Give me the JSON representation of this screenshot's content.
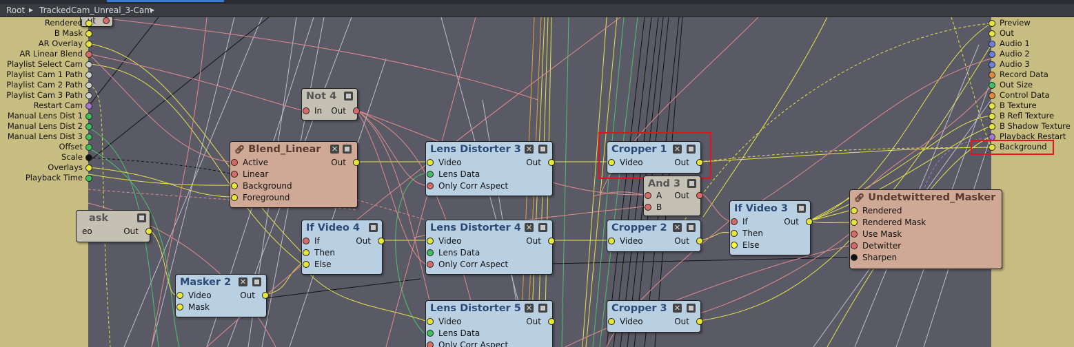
{
  "breadcrumb": {
    "root": "Root",
    "sep": "▶",
    "current": "TrackedCam_Unreal_3-Cam"
  },
  "colors": {
    "yellow": "#e6e63a",
    "red": "#d96a6a",
    "green": "#3fbf5f",
    "grey": "#cfcfcf",
    "purple": "#a875d6",
    "orange": "#e08a3a",
    "blue": "#6b80e0",
    "black": "#111111",
    "wire_pink": "#e08c8c",
    "wire_yellow": "#e8e24a",
    "wire_white": "#d8d8e6"
  },
  "left_panel": {
    "pins": [
      {
        "label": "Rendered",
        "color": "#e6e63a"
      },
      {
        "label": "B Mask",
        "color": "#e6e63a"
      },
      {
        "label": "AR Overlay",
        "color": "#e6e63a"
      },
      {
        "label": "AR Linear Blend",
        "color": "#d96a6a"
      },
      {
        "label": "Playlist Select Cam",
        "color": "#cfcfcf"
      },
      {
        "label": "Playlist Cam 1 Path",
        "color": "#cfcfcf"
      },
      {
        "label": "Playlist Cam 2 Path",
        "color": "#cfcfcf"
      },
      {
        "label": "Playlist Cam 3 Path",
        "color": "#cfcfcf"
      },
      {
        "label": "Restart Cam",
        "color": "#a875d6"
      },
      {
        "label": "Manual Lens Dist 1",
        "color": "#3fbf5f"
      },
      {
        "label": "Manual Lens Dist 2",
        "color": "#3fbf5f"
      },
      {
        "label": "Manual Lens Dist 3",
        "color": "#3fbf5f"
      },
      {
        "label": "Offset",
        "color": "#3fbf5f"
      },
      {
        "label": "Scale",
        "color": "#111111"
      },
      {
        "label": "Overlays",
        "color": "#e6e63a"
      },
      {
        "label": "Playback Time",
        "color": "#3fbf5f"
      }
    ],
    "top_partial": "ut"
  },
  "right_panel": {
    "pins": [
      {
        "label": "Preview",
        "color": "#e6e63a"
      },
      {
        "label": "Out",
        "color": "#e6e63a"
      },
      {
        "label": "Audio 1",
        "color": "#6b80e0"
      },
      {
        "label": "Audio 2",
        "color": "#6b80e0"
      },
      {
        "label": "Audio 3",
        "color": "#6b80e0"
      },
      {
        "label": "Record Data",
        "color": "#e08a3a"
      },
      {
        "label": "Out Size",
        "color": "#3fbf5f"
      },
      {
        "label": "Control Data",
        "color": "#e08a3a"
      },
      {
        "label": "B Texture",
        "color": "#e6e63a"
      },
      {
        "label": "B Refl Texture",
        "color": "#e6e63a"
      },
      {
        "label": "B Shadow Texture",
        "color": "#e6e63a"
      },
      {
        "label": "Playback Restart",
        "color": "#a875d6"
      },
      {
        "label": "Background",
        "color": "#e6e63a"
      }
    ]
  },
  "nodes": {
    "not4": {
      "title": "Not 4",
      "in": [
        "In"
      ],
      "out": "Out"
    },
    "blend_linear": {
      "title": "Blend_Linear",
      "in": [
        "Active",
        "Linear",
        "Background",
        "Foreground"
      ],
      "out": "Out"
    },
    "lens3": {
      "title": "Lens Distorter 3",
      "in": [
        "Video",
        "Lens Data",
        "Only Corr Aspect"
      ],
      "out": "Out"
    },
    "lens4": {
      "title": "Lens Distorter 4",
      "in": [
        "Video",
        "Lens Data",
        "Only Corr Aspect"
      ],
      "out": "Out"
    },
    "lens5": {
      "title": "Lens Distorter 5",
      "in": [
        "Video",
        "Lens Data",
        "Only Corr Aspect"
      ],
      "out": "Out"
    },
    "cropper1": {
      "title": "Cropper 1",
      "in": [
        "Video"
      ],
      "out": "Out"
    },
    "cropper2": {
      "title": "Cropper 2",
      "in": [
        "Video"
      ],
      "out": "Out"
    },
    "cropper3": {
      "title": "Cropper 3",
      "in": [
        "Video"
      ],
      "out": "Out"
    },
    "and3": {
      "title": "And 3",
      "in": [
        "A",
        "B"
      ],
      "out": "Out"
    },
    "ifvideo4": {
      "title": "If Video 4",
      "in": [
        "If",
        "Then",
        "Else"
      ],
      "out": "Out"
    },
    "ifvideo3": {
      "title": "If Video 3",
      "in": [
        "If",
        "Then",
        "Else"
      ],
      "out": "Out"
    },
    "masker2": {
      "title": "Masker 2",
      "in": [
        "Video",
        "Mask"
      ],
      "out": "Out"
    },
    "partial_mask": {
      "title": "ask",
      "in": [
        "eo"
      ],
      "out": "Out"
    },
    "undetwittered": {
      "title": "Undetwittered_Masker",
      "in": [
        "Rendered",
        "Rendered Mask",
        "Use Mask",
        "Detwitter",
        "Sharpen"
      ]
    }
  },
  "icons": {
    "close": "✕",
    "link": "link-icon",
    "menu": "menu-icon",
    "edit": "✎"
  }
}
